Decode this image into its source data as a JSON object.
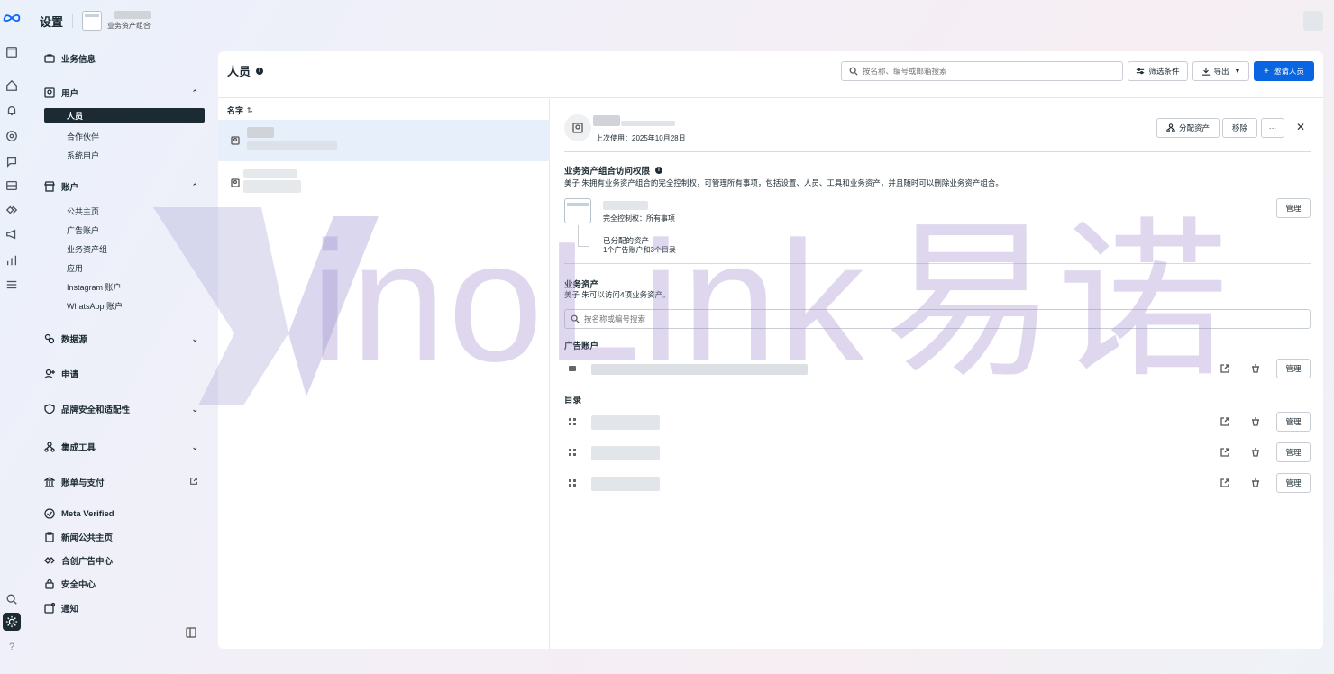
{
  "app": {
    "title": "设置",
    "portfolio_subtitle": "业务资产组合"
  },
  "sidebar": {
    "business_info": "业务信息",
    "users": {
      "label": "用户",
      "items": [
        "人员",
        "合作伙伴",
        "系统用户"
      ],
      "selected": "人员"
    },
    "accounts": {
      "label": "账户",
      "items": [
        "公共主页",
        "广告账户",
        "业务资产组",
        "应用",
        "Instagram 账户",
        "WhatsApp 账户"
      ]
    },
    "data_sources": "数据源",
    "requests": "申请",
    "brand_safety": "品牌安全和适配性",
    "integrations": "集成工具",
    "billing": "账单与支付",
    "meta_verified": "Meta Verified",
    "news_page": "新闻公共主页",
    "creative_hub": "合创广告中心",
    "security_center": "安全中心",
    "notifications": "通知"
  },
  "header": {
    "page_title": "人员",
    "search_placeholder": "按名称、编号或邮箱搜索",
    "filter_label": "筛选条件",
    "export_label": "导出",
    "invite_label": "邀请人员"
  },
  "list": {
    "column_name": "名字"
  },
  "detail": {
    "last_used": "上次使用：2025年10月28日",
    "assign_assets": "分配资产",
    "remove": "移除",
    "more": "···",
    "close": "✕",
    "access_title": "业务资产组合访问权限",
    "access_desc": "美子 朱拥有业务资产组合的完全控制权，可管理所有事项，包括设置、人员、工具和业务资产，并且随时可以删除业务资产组合。",
    "full_control": "完全控制权：所有事项",
    "assigned_assets": "已分配的资产",
    "assigned_summary": "1个广告账户和3个目录",
    "manage": "管理",
    "assets_title": "业务资产",
    "assets_desc": "美子 朱可以访问4项业务资产。",
    "assets_search_placeholder": "按名称或编号搜索",
    "ad_accounts_title": "广告账户",
    "catalogs_title": "目录"
  },
  "watermark": {
    "latin": "inoLink",
    "chinese": "易诺"
  },
  "colors": {
    "primary": "#0a66e0",
    "dark": "#1c2b33",
    "selected_row": "#e7effa"
  }
}
